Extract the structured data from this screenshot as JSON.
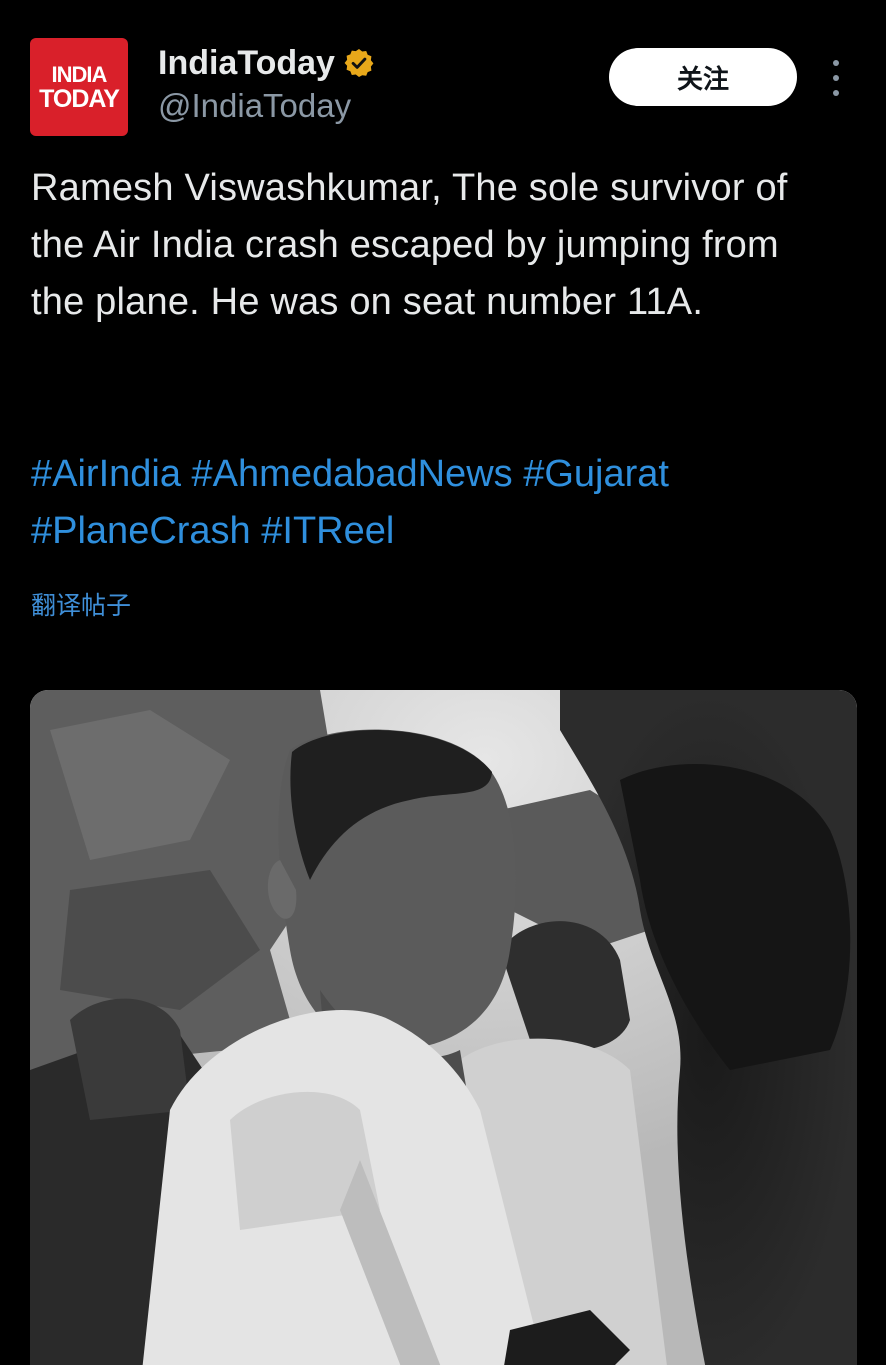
{
  "account": {
    "avatar_line1": "INDIA",
    "avatar_line2": "TODAY",
    "display_name": "IndiaToday",
    "handle": "@IndiaToday",
    "verified_icon": "verified-badge-gold",
    "avatar_color": "#d9202a"
  },
  "actions": {
    "follow_label": "关注",
    "more_icon": "more-vertical-icon"
  },
  "post": {
    "text": "Ramesh Viswashkumar, The sole survivor of the Air India crash escaped by jumping from the plane. He was on seat number 11A.",
    "hashtags": [
      "#AirIndia",
      "#AhmedabadNews",
      "#Gujarat",
      "#PlaneCrash",
      "#ITReel"
    ],
    "translate_label": "翻译帖子"
  },
  "colors": {
    "background": "#000000",
    "text": "#e7e9ea",
    "secondary_text": "#8b98a5",
    "link": "#2f8fdd"
  }
}
